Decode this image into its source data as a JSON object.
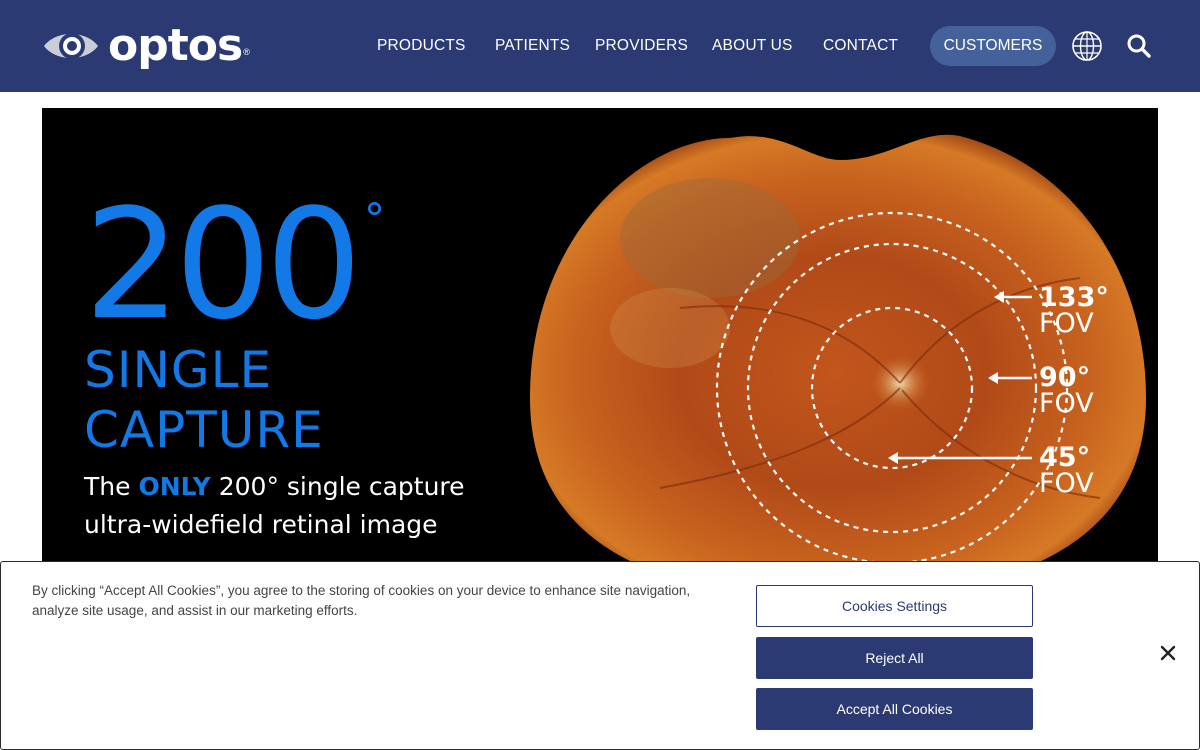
{
  "header": {
    "logo_text": "optos",
    "logo_reg": "®",
    "nav": [
      {
        "label": "PRODUCTS"
      },
      {
        "label": "PATIENTS"
      },
      {
        "label": "PROVIDERS"
      },
      {
        "label": "ABOUT US"
      },
      {
        "label": "CONTACT"
      }
    ],
    "customers_label": "CUSTOMERS",
    "globe_icon": "globe-icon",
    "search_icon": "search-icon"
  },
  "hero": {
    "big_number": "200",
    "degree": "°",
    "line1": "SINGLE",
    "line2": "CAPTURE",
    "sub_pre": "The ",
    "sub_highlight": "ONLY",
    "sub_post": " 200° single capture",
    "sub_line2": "ultra-widefield retinal image",
    "fov": [
      {
        "degree": "133°",
        "label": "FOV"
      },
      {
        "degree": "90°",
        "label": "FOV"
      },
      {
        "degree": "45°",
        "label": "FOV"
      }
    ]
  },
  "cookie": {
    "text": "By clicking “Accept All Cookies”, you agree to the storing of cookies on your device to enhance site navigation, analyze site usage, and assist in our marketing efforts.",
    "settings_label": "Cookies Settings",
    "reject_label": "Reject All",
    "accept_label": "Accept All Cookies",
    "close_icon": "close-icon"
  },
  "colors": {
    "header_bg": "#2b3a73",
    "accent_blue": "#1279e6",
    "customers_pill": "#45619c",
    "button_navy": "#2b3a73"
  }
}
